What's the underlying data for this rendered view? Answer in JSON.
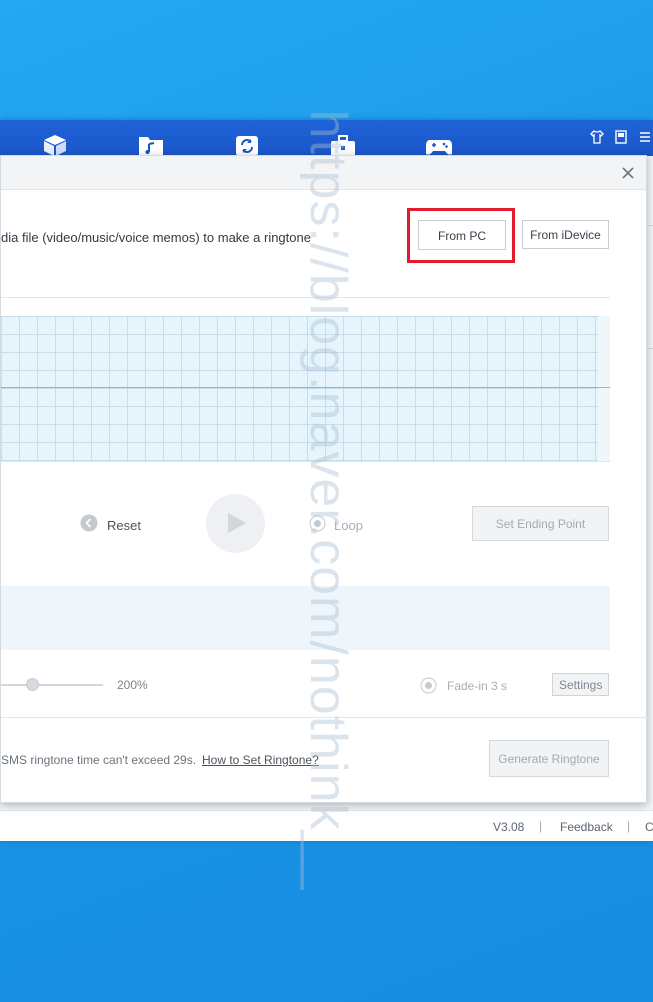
{
  "dialog": {
    "instruction": "dia file (video/music/voice memos) to make a ringtone",
    "from_pc_label": "From PC",
    "from_idevice_label": "From iDevice",
    "reset_label": "Reset",
    "loop_label": "Loop",
    "set_ending_label": "Set Ending Point",
    "volume_max_label": "200%",
    "volume_level_percent": 25,
    "fade_label": "Fade-in 3 s",
    "settings_label": "Settings",
    "sms_note": "SMS ringtone time can't exceed 29s.",
    "how_to_link": "How to Set Ringtone?",
    "generate_label": "Generate Ringtone",
    "close_icon": "close-icon"
  },
  "app": {
    "nav_icons": [
      "cube-icon",
      "music-folder-icon",
      "sync-icon",
      "toolbox-icon",
      "gamepad-icon"
    ],
    "window_controls": [
      "shirt-icon",
      "note-icon",
      "menu-icon"
    ]
  },
  "statusbar": {
    "version": "V3.08",
    "feedback": "Feedback",
    "separator": "|",
    "trailing": "C"
  },
  "watermark": {
    "text": "https://blog.naver.com/nothink__"
  },
  "colors": {
    "desktop_blue": "#1e9be8",
    "topbar_blue": "#1a56c8",
    "highlight_red": "#e21b2d"
  }
}
